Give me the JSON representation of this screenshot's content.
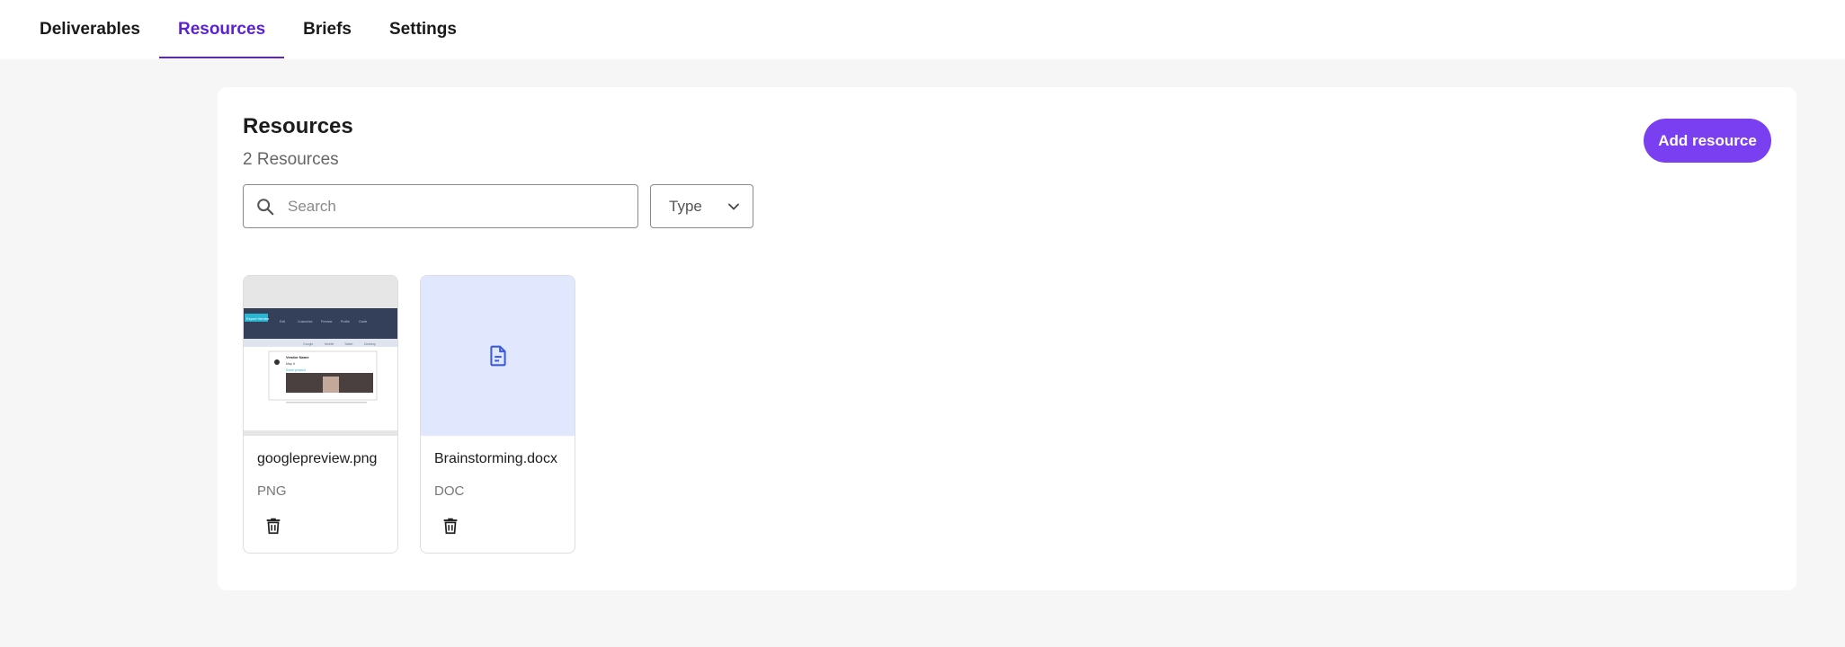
{
  "tabs": [
    {
      "label": "Deliverables"
    },
    {
      "label": "Resources"
    },
    {
      "label": "Briefs"
    },
    {
      "label": "Settings"
    }
  ],
  "active_tab": "Resources",
  "main": {
    "title": "Resources",
    "count": "2 Resources",
    "add_button": "Add resource",
    "search_placeholder": "Search",
    "type_filter": "Type"
  },
  "resources": [
    {
      "name": "googlepreview.png",
      "type": "PNG",
      "thumb": "image-preview"
    },
    {
      "name": "Brainstorming.docx",
      "type": "DOC",
      "thumb": "document-icon"
    }
  ],
  "colors": {
    "accent": "#7b3ff2",
    "active_tab": "#5b21d6",
    "doc_thumb_bg": "#e1e8fd",
    "doc_icon": "#3b5bdb"
  },
  "preview_text": {
    "badge": "Export Vendor",
    "nav": [
      "Edit",
      "Customize",
      "Preview",
      "Profile",
      "Guide"
    ],
    "subnav": [
      "Google",
      "Mobile",
      "Tablet",
      "Desktop"
    ],
    "vendor": "Vendor Name",
    "sub": "Map It",
    "link": "Some product"
  }
}
